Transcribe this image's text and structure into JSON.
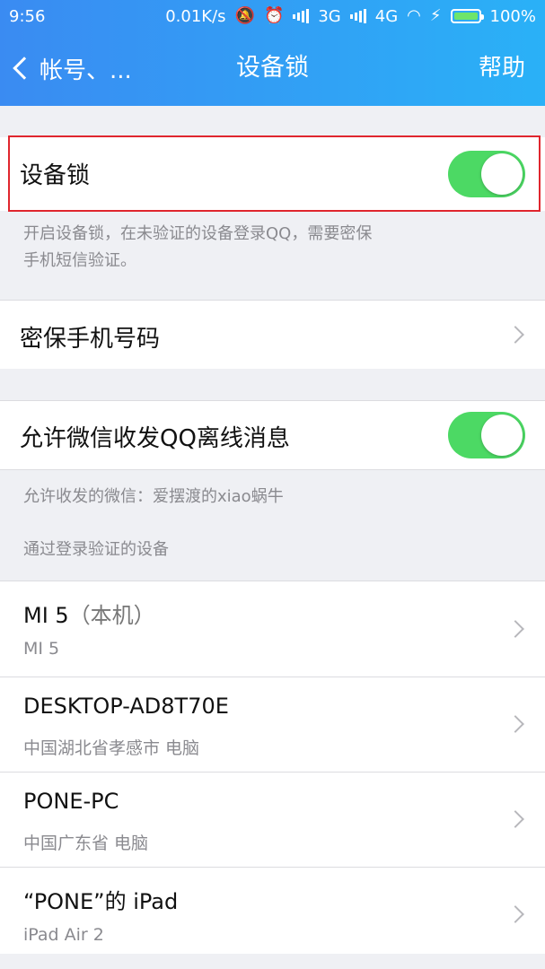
{
  "status_bar": {
    "time": "9:56",
    "speed": "0.01K/s",
    "network_3g": "3G",
    "network_4g": "4G",
    "battery_percent": "100%"
  },
  "nav": {
    "back_label": "帐号、...",
    "title": "设备锁",
    "help_label": "帮助"
  },
  "device_lock": {
    "label": "设备锁",
    "enabled": true,
    "description_line1": "开启设备锁，在未验证的设备登录QQ，需要密保",
    "description_line2": "手机短信验证。"
  },
  "secure_phone": {
    "label": "密保手机号码"
  },
  "wechat": {
    "label": "允许微信收发QQ离线消息",
    "enabled": true,
    "allowed_text": "允许收发的微信：爱摆渡的xiao蜗牛"
  },
  "verified_devices": {
    "section_title": "通过登录验证的设备",
    "items": [
      {
        "name": "MI 5",
        "suffix": "（本机）",
        "detail": "MI 5"
      },
      {
        "name": "DESKTOP-AD8T70E",
        "suffix": "",
        "detail": "中国湖北省孝感市 电脑"
      },
      {
        "name": "PONE-PC",
        "suffix": "",
        "detail": "中国广东省 电脑"
      },
      {
        "name": "“PONE”的 iPad",
        "suffix": "",
        "detail": "iPad Air 2"
      }
    ]
  },
  "colors": {
    "header_start": "#3a8bf2",
    "header_end": "#2ab1f7",
    "toggle_on": "#4cd964",
    "highlight_border": "#e0262e"
  }
}
